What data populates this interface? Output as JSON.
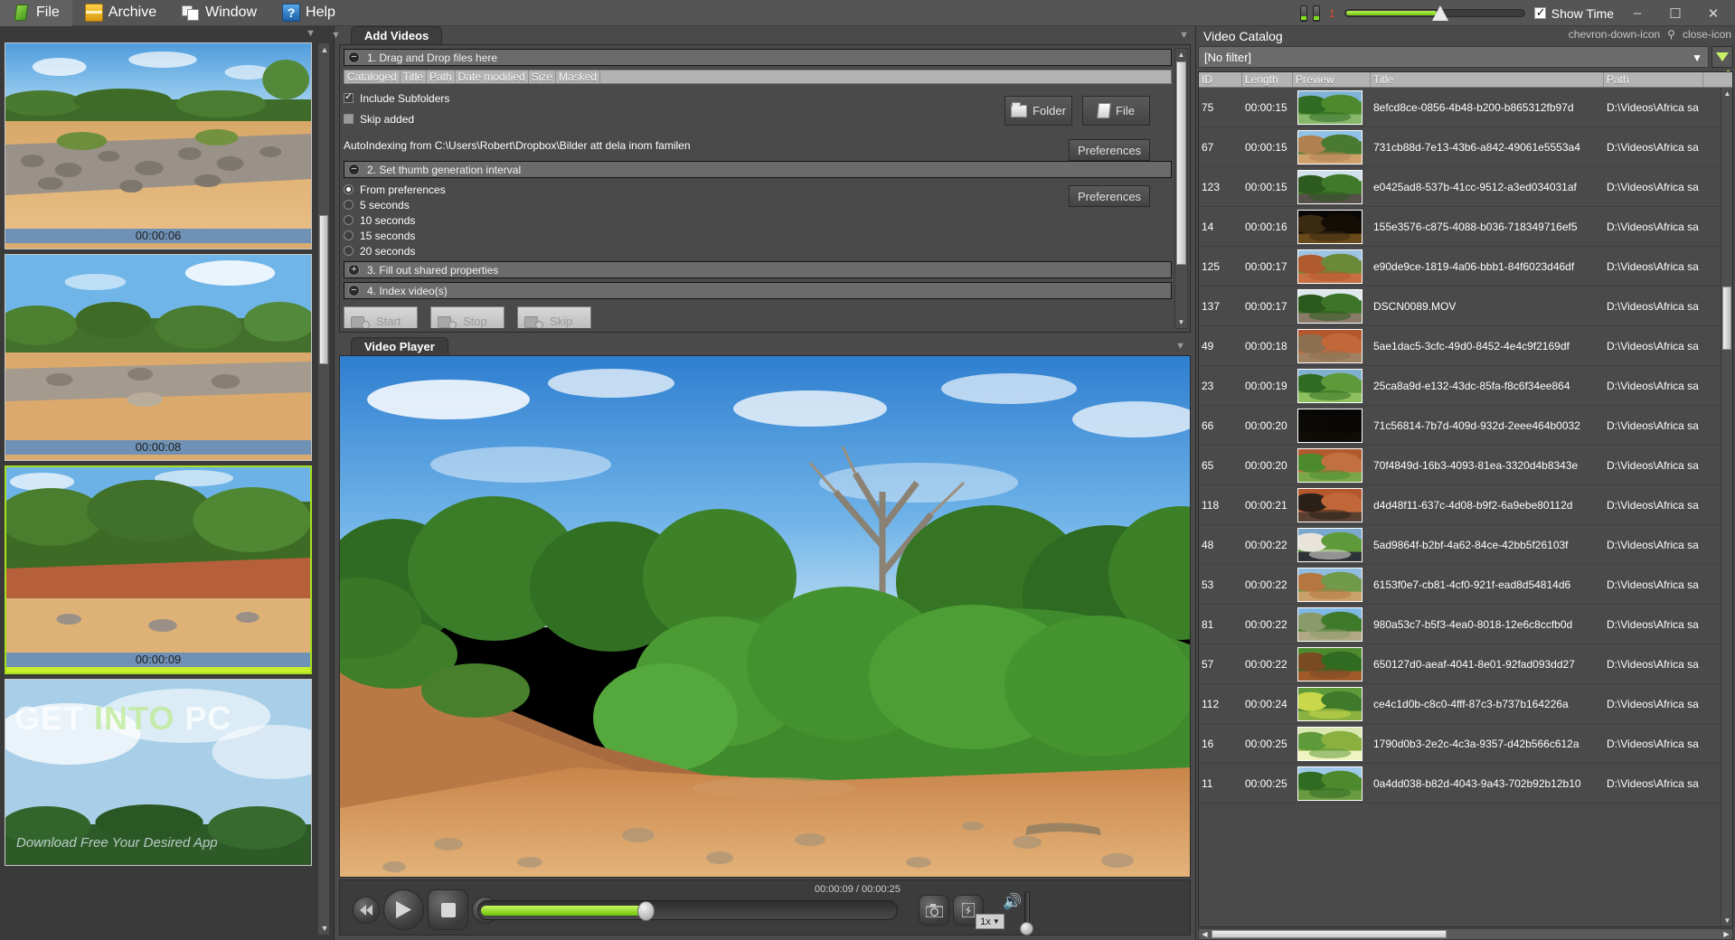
{
  "menu": {
    "items": [
      {
        "label": "File",
        "icon": "file-page-icon"
      },
      {
        "label": "Archive",
        "icon": "archive-box-icon"
      },
      {
        "label": "Window",
        "icon": "window-panes-icon"
      },
      {
        "label": "Help",
        "icon": "help-question-icon"
      }
    ]
  },
  "topbar": {
    "binoculars_icon": "binoculars-icon",
    "volume_value": "1",
    "show_time_label": "Show Time",
    "show_time_checked": true,
    "minimize": "–",
    "maximize": "☐",
    "close": "✕"
  },
  "thumbstrip": {
    "items": [
      {
        "time": "00:00:06",
        "selected": false
      },
      {
        "time": "00:00:08",
        "selected": false
      },
      {
        "time": "00:00:09",
        "selected": true
      },
      {
        "time": "",
        "selected": false,
        "watermark": true
      }
    ],
    "watermark": {
      "line1_a": "GET ",
      "line1_b": "INTO",
      "line1_c": " PC",
      "line2": "Download Free Your Desired App"
    }
  },
  "center": {
    "tab_label": "Add Videos",
    "step1": {
      "title": "1. Drag and Drop files here",
      "expander": "−",
      "columns": [
        "Cataloged",
        "Title",
        "Path",
        "Date modified",
        "Size",
        "Masked"
      ],
      "include_subfolders_label": "Include Subfolders",
      "include_subfolders_checked": true,
      "skip_added_label": "Skip added",
      "skip_added_checked": false,
      "autoindex_text": "AutoIndexing from C:\\Users\\Robert\\Dropbox\\Bilder att dela inom familen",
      "folder_button": "Folder",
      "file_button": "File",
      "preferences_button": "Preferences"
    },
    "step2": {
      "title": "2. Set thumb generation interval",
      "expander": "−",
      "options": [
        {
          "label": "From preferences",
          "selected": true
        },
        {
          "label": "5 seconds",
          "selected": false
        },
        {
          "label": "10 seconds",
          "selected": false
        },
        {
          "label": "15 seconds",
          "selected": false
        },
        {
          "label": "20 seconds",
          "selected": false
        }
      ],
      "preferences_button": "Preferences"
    },
    "step3": {
      "title": "3. Fill out shared properties",
      "expander": "+"
    },
    "step4": {
      "title": "4. Index video(s)",
      "expander": "−",
      "start_button": "Start",
      "stop_button": "Stop",
      "skip_button": "Skip"
    }
  },
  "player": {
    "tab_label": "Video Player",
    "rewind_icon": "rewind-icon",
    "play_icon": "play-icon",
    "stop_icon": "stop-icon",
    "forward_icon": "fast-forward-icon",
    "time_display": "00:00:09 / 00:00:25",
    "progress_percent": 38,
    "snapshot_icon": "camera-snapshot-icon",
    "clip_icon": "clip-icon",
    "speed_label": "1x",
    "speed_caret": "▼",
    "volume_icon": "speaker-icon"
  },
  "catalog": {
    "title": "Video Catalog",
    "filter_value": "[No filter]",
    "filter_caret": "▼",
    "filter_icon": "funnel-icon",
    "pin_icon": "pin-icon",
    "close_icon": "close-icon",
    "menu_icon": "chevron-down-icon",
    "columns": [
      "ID",
      "Length",
      "Preview",
      "Title",
      "Path"
    ],
    "rows": [
      {
        "id": "75",
        "length": "00:00:15",
        "title": "8efcd8ce-0856-4b48-b200-b865312fb97d",
        "path": "D:\\Videos\\Africa sa",
        "thumb": "river-green"
      },
      {
        "id": "67",
        "length": "00:00:15",
        "title": "731cb88d-7e13-43b6-a842-49061e5553a4",
        "path": "D:\\Videos\\Africa sa",
        "thumb": "jeep-road"
      },
      {
        "id": "123",
        "length": "00:00:15",
        "title": "e0425ad8-537b-41cc-9512-a3ed034031af",
        "path": "D:\\Videos\\Africa sa",
        "thumb": "elephant-bush"
      },
      {
        "id": "14",
        "length": "00:00:16",
        "title": "155e3576-c875-4088-b036-718349716ef5",
        "path": "D:\\Videos\\Africa sa",
        "thumb": "night-dark"
      },
      {
        "id": "125",
        "length": "00:00:17",
        "title": "e90de9ce-1819-4a06-bbb1-84f6023d46df",
        "path": "D:\\Videos\\Africa sa",
        "thumb": "red-savanna"
      },
      {
        "id": "137",
        "length": "00:00:17",
        "title": "DSCN0089.MOV",
        "path": "D:\\Videos\\Africa sa",
        "thumb": "elephant-trees"
      },
      {
        "id": "49",
        "length": "00:00:18",
        "title": "5ae1dac5-3cfc-49d0-8452-4e4c9f2169df",
        "path": "D:\\Videos\\Africa sa",
        "thumb": "tortoise-sand"
      },
      {
        "id": "23",
        "length": "00:00:19",
        "title": "25ca8a9d-e132-43dc-85fa-f8c6f34ee864",
        "path": "D:\\Videos\\Africa sa",
        "thumb": "river-bank"
      },
      {
        "id": "66",
        "length": "00:00:20",
        "title": "71c56814-7b7d-409d-932d-2eee464b0032",
        "path": "D:\\Videos\\Africa sa",
        "thumb": "black"
      },
      {
        "id": "65",
        "length": "00:00:20",
        "title": "70f4849d-16b3-4093-81ea-3320d4b8343e",
        "path": "D:\\Videos\\Africa sa",
        "thumb": "elephant-far"
      },
      {
        "id": "118",
        "length": "00:00:21",
        "title": "d4d48f11-637c-4d08-b9f2-6a9ebe80112d",
        "path": "D:\\Videos\\Africa sa",
        "thumb": "millipede"
      },
      {
        "id": "48",
        "length": "00:00:22",
        "title": "5ad9864f-b2bf-4a62-84ce-42bb5f26103f",
        "path": "D:\\Videos\\Africa sa",
        "thumb": "table-people"
      },
      {
        "id": "53",
        "length": "00:00:22",
        "title": "6153f0e7-cb81-4cf0-921f-ead8d54814d6",
        "path": "D:\\Videos\\Africa sa",
        "thumb": "dry-valley"
      },
      {
        "id": "81",
        "length": "00:00:22",
        "title": "980a53c7-b5f3-4ea0-8018-12e6c8ccfb0d",
        "path": "D:\\Videos\\Africa sa",
        "thumb": "path-bush"
      },
      {
        "id": "57",
        "length": "00:00:22",
        "title": "650127d0-aeaf-4041-8e01-92fad093dd27",
        "path": "D:\\Videos\\Africa sa",
        "thumb": "tree-trunk"
      },
      {
        "id": "112",
        "length": "00:00:24",
        "title": "ce4c1d0b-c8c0-4fff-87c3-b737b164226a",
        "path": "D:\\Videos\\Africa sa",
        "thumb": "leaves"
      },
      {
        "id": "16",
        "length": "00:00:25",
        "title": "1790d0b3-2e2c-4c3a-9357-d42b566c612a",
        "path": "D:\\Videos\\Africa sa",
        "thumb": "sunlit-green"
      },
      {
        "id": "11",
        "length": "00:00:25",
        "title": "0a4dd038-b82d-4043-9a43-702b92b12b10",
        "path": "D:\\Videos\\Africa sa",
        "thumb": "sky-bush"
      }
    ]
  },
  "colors": {
    "accent_green": "#7ee01c",
    "panel_bg": "#4a4a4a",
    "header_gray": "#b3b3b3",
    "selection_green": "#a8e020"
  }
}
